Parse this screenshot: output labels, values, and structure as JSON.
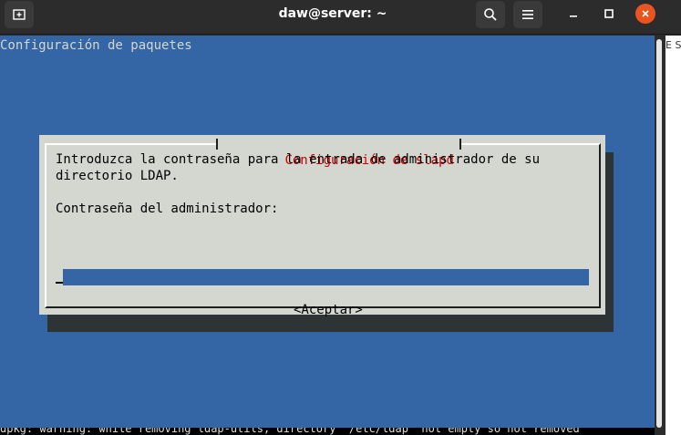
{
  "window": {
    "title": "daw@server: ~"
  },
  "terminal": {
    "backtitle": "Configuración de paquetes"
  },
  "dialog": {
    "title": "Configuración de slapd",
    "message_line1": "Introduzca la contraseña para la entrada de administrador de su",
    "message_line2": "directorio LDAP.",
    "field_label": "Contraseña del administrador:",
    "password_value": "",
    "accept_label": "<Aceptar>"
  },
  "background": {
    "right_edge_text": "E SC",
    "bottom_text": "dpkg: warning: while removing ldap-utils, directory '/etc/ldap' not empty so not removed"
  },
  "icons": {
    "new_tab": "new-tab-icon",
    "search": "search-icon",
    "menu": "hamburger-menu-icon",
    "minimize": "minimize-icon",
    "maximize": "maximize-icon",
    "close": "close-icon"
  },
  "colors": {
    "terminal_bg": "#3465a4",
    "dialog_bg": "#d3d7cf",
    "dialog_title": "#cc0000",
    "close_button": "#e95420"
  }
}
